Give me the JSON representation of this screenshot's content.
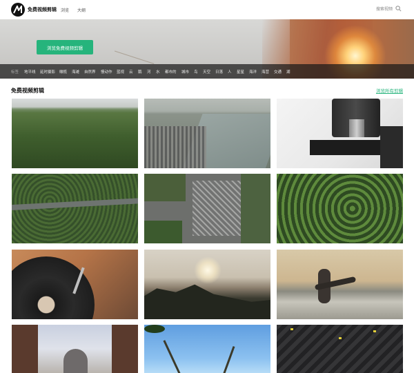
{
  "header": {
    "brand": "免费视频剪辑",
    "nav": [
      "浏览",
      "大纲"
    ],
    "search_label": "搜索视频"
  },
  "hero": {
    "cta_label": "浏览免费视频剪辑",
    "tags": [
      "标签",
      "地平线",
      "延时摄影",
      "橄榄",
      "海滩",
      "自然界",
      "慢动作",
      "蓝视",
      "云",
      "鹅",
      "河",
      "水",
      "都市的",
      "城市",
      "鸟",
      "天空",
      "日落",
      "人",
      "星星",
      "海洋",
      "海营",
      "交通",
      "湖"
    ]
  },
  "section": {
    "title": "免费视频剪辑",
    "browse_all": "浏览所有剪辑"
  },
  "thumbnails": [
    {
      "subject": "pine forest aerial"
    },
    {
      "subject": "river harbor city"
    },
    {
      "subject": "microscope"
    },
    {
      "subject": "road through forest aerial"
    },
    {
      "subject": "city intersection aerial"
    },
    {
      "subject": "tree tops aerial"
    },
    {
      "subject": "vinyl record player"
    },
    {
      "subject": "sunset over trees"
    },
    {
      "subject": "surfer on beach"
    },
    {
      "subject": "taj mahal"
    },
    {
      "subject": "palm trees blue sky"
    },
    {
      "subject": "night city intersection aerial"
    }
  ],
  "colors": {
    "accent": "#26b47c",
    "tagbar": "#1e1e1e"
  }
}
